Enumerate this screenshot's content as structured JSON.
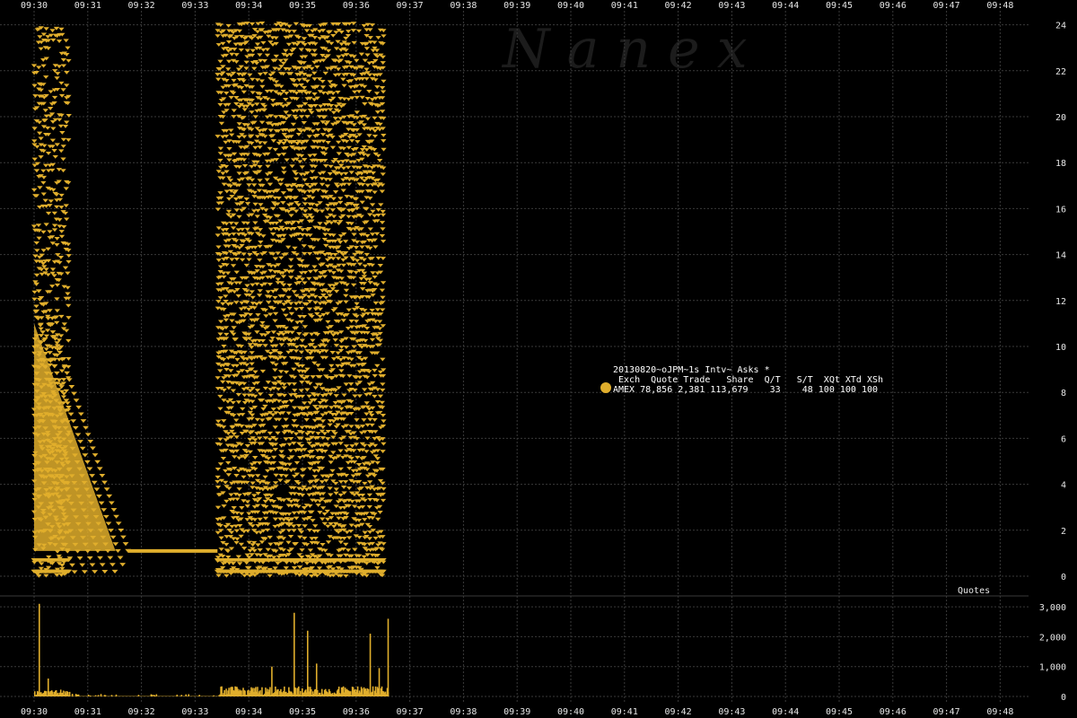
{
  "watermark": "N a n e x",
  "legend": {
    "title": "20130820~oJPM~1s Intv~ Asks *",
    "header": " Exch  Quote Trade   Share  Q/T   S/T  XQt XTd XSh",
    "row": "AMEX 78,856 2,381 113,679    33    48 100 100 100"
  },
  "lower_panel_label": "Quotes",
  "colors": {
    "background": "#000000",
    "series": "#e0ae2c",
    "grid": "#3a3a3a",
    "text": "#e6e6e6"
  },
  "chart_data": [
    {
      "type": "scatter",
      "title": "",
      "xlabel": "",
      "ylabel": "",
      "x_ticks": [
        "09:30",
        "09:31",
        "09:32",
        "09:33",
        "09:34",
        "09:35",
        "09:36",
        "09:37",
        "09:38",
        "09:39",
        "09:40",
        "09:41",
        "09:42",
        "09:43",
        "09:44",
        "09:45",
        "09:46",
        "09:47",
        "09:48"
      ],
      "y_ticks": [
        "0",
        "2",
        "4",
        "6",
        "8",
        "10",
        "12",
        "14",
        "16",
        "18",
        "20",
        "22",
        "24"
      ],
      "ylim": [
        0,
        24.4
      ],
      "grid": true,
      "series": [
        {
          "name": "AMEX",
          "marker": "triangle-down",
          "description_ranges": [
            {
              "x_start": "09:30:00",
              "x_end": "09:30:40",
              "y_min": 0,
              "y_max": 24
            },
            {
              "x_start": "09:33:25",
              "x_end": "09:36:32",
              "y_min": 0,
              "y_max": 24.2
            }
          ],
          "diagonal_decay": {
            "start": [
              "09:30:00",
              13
            ],
            "end": [
              "09:31:45",
              1.1
            ]
          },
          "flat_level": {
            "x_start": "09:31:45",
            "x_end": "09:33:25",
            "y": 1.1
          }
        }
      ]
    },
    {
      "type": "bar",
      "title": "",
      "ylabel": "",
      "y_ticks": [
        "0",
        "1,000",
        "2,000",
        "3,000"
      ],
      "ylim": [
        0,
        3200
      ],
      "grid": true,
      "peaks": [
        {
          "x": "09:30:05",
          "y": 3100
        },
        {
          "x": "09:30:15",
          "y": 600
        },
        {
          "x": "09:34:50",
          "y": 2800
        },
        {
          "x": "09:34:25",
          "y": 1000
        },
        {
          "x": "09:35:05",
          "y": 2200
        },
        {
          "x": "09:35:15",
          "y": 1100
        },
        {
          "x": "09:36:15",
          "y": 2100
        },
        {
          "x": "09:36:35",
          "y": 2600
        },
        {
          "x": "09:36:25",
          "y": 950
        }
      ]
    }
  ]
}
